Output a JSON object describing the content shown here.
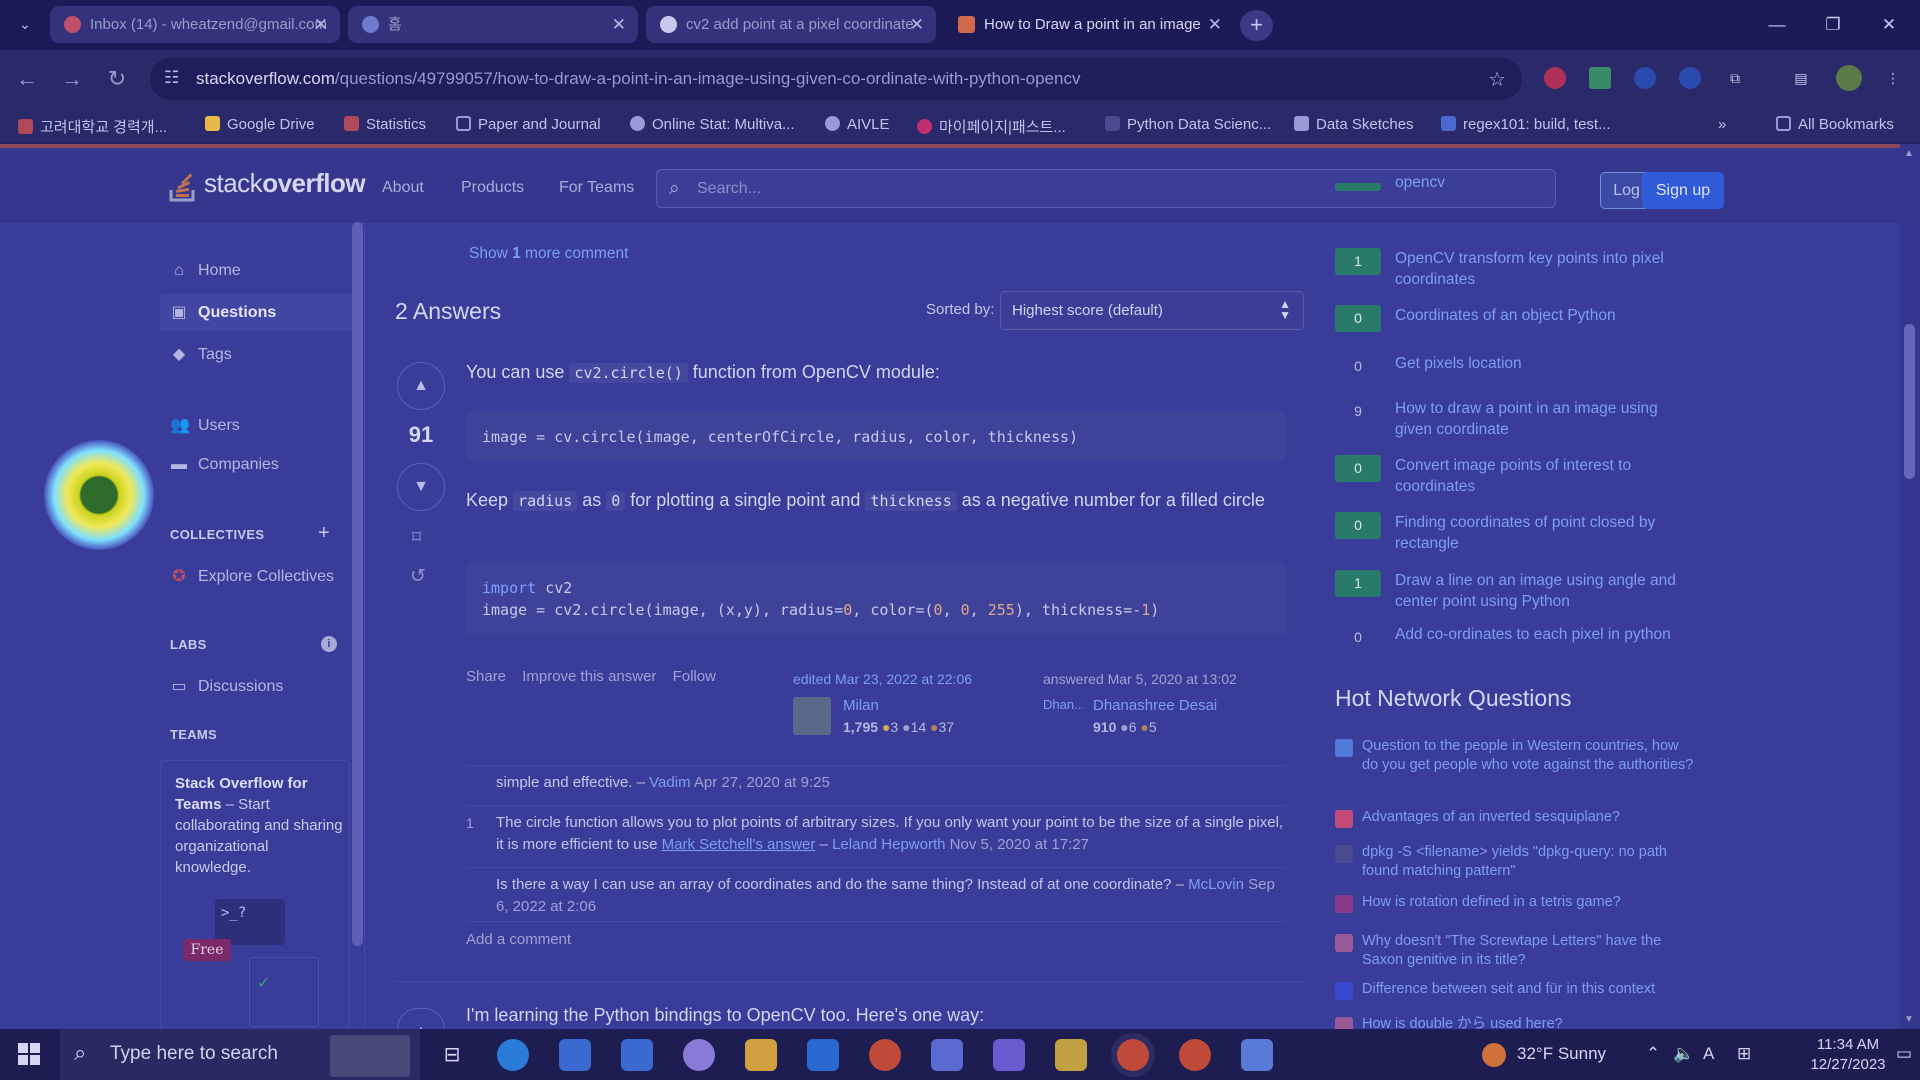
{
  "browser": {
    "tabs": [
      {
        "title": "Inbox (14) - wheatzend@gmail.com",
        "fav_color": "#c0506a"
      },
      {
        "title": "홈",
        "fav_color": "#6c7bd0"
      },
      {
        "title": "cv2 add point at a pixel coordinate",
        "fav_color": "#c9c8ee"
      },
      {
        "title": "How to Draw a point in an image",
        "fav_color": "#d06a4a"
      }
    ],
    "url_host": "stackoverflow.com",
    "url_path": "/questions/49799057/how-to-draw-a-point-in-an-image-using-given-co-ordinate-with-python-opencv",
    "bookmarks": [
      {
        "label": "고려대학교 경력개...",
        "color": "#b04a5a"
      },
      {
        "label": "Google Drive",
        "color": "#e8b84a"
      },
      {
        "label": "Statistics",
        "color": "#b04a5a"
      },
      {
        "label": "Paper and Journal",
        "color": "#9a9ad8"
      },
      {
        "label": "Online Stat: Multiva...",
        "color": "#9a9ad8"
      },
      {
        "label": "AIVLE",
        "color": "#9a9ad8"
      },
      {
        "label": "마이페이지|패스트...",
        "color": "#c03070"
      },
      {
        "label": "Python Data Scienc...",
        "color": "#4a4a90"
      },
      {
        "label": "Data Sketches",
        "color": "#9a9ad8"
      },
      {
        "label": "regex101: build, test...",
        "color": "#4a6ad0"
      }
    ],
    "all_bookmarks": "All Bookmarks",
    "more_bookmarks": "»"
  },
  "header": {
    "logo_prefix": "stack",
    "logo_bold": "overflow",
    "nav": [
      "About",
      "Products",
      "For Teams"
    ],
    "search_placeholder": "Search...",
    "login": "Log in",
    "signup": "Sign up"
  },
  "sidebar": {
    "items": [
      {
        "label": "Home",
        "icon": "home-icon",
        "glyph": "⌂"
      },
      {
        "label": "Questions",
        "icon": "questions-icon",
        "glyph": "▣"
      },
      {
        "label": "Tags",
        "icon": "tag-icon",
        "glyph": "◆"
      },
      {
        "label": "Users",
        "icon": "users-icon",
        "glyph": "👥"
      },
      {
        "label": "Companies",
        "icon": "briefcase-icon",
        "glyph": "▬"
      }
    ],
    "collectives_title": "COLLECTIVES",
    "explore_collectives": "Explore Collectives",
    "labs_title": "LABS",
    "discussions": "Discussions",
    "teams_title": "TEAMS",
    "teams_heading": "Stack Overflow for Teams",
    "teams_text": " – Start collaborating and sharing organizational knowledge.",
    "teams_badge": "Free",
    "teams_prompt": ">_?"
  },
  "main": {
    "show_more_pre": "Show ",
    "show_more_num": "1",
    "show_more_post": " more comment",
    "answers_heading": "2 Answers",
    "sorted_by": "Sorted by:",
    "sort_value": "Highest score (default)",
    "answer1": {
      "score": "91",
      "p1_pre": "You can use ",
      "p1_code": "cv2.circle()",
      "p1_post": " function from OpenCV module:",
      "code1": "image = cv.circle(image, centerOfCircle, radius, color, thickness)",
      "p2_a": "Keep ",
      "p2_code1": "radius",
      "p2_b": " as ",
      "p2_code2": "0",
      "p2_c": " for plotting a single point and ",
      "p2_code3": "thickness",
      "p2_d": " as a negative number for a filled circle",
      "code2_kw": "import",
      "code2_mod": " cv2",
      "code2_line2_pre": "image = cv2.circle(image, (x,y), radius=",
      "code2_r": "0",
      "code2_mid": ", color=(",
      "code2_c1": "0",
      "code2_sep": ", ",
      "code2_c2": "0",
      "code2_c3": "255",
      "code2_mid2": "), thickness=-",
      "code2_t": "1",
      "code2_end": ")",
      "actions": [
        "Share",
        "Improve this answer",
        "Follow"
      ],
      "edited": "edited Mar 23, 2022 at 22:06",
      "editor": "Milan",
      "editor_rep": "1,795",
      "editor_gold": "3",
      "editor_silver": "14",
      "editor_bronze": "37",
      "answered": "answered Mar 5, 2020 at 13:02",
      "author": "Dhanashree Desai",
      "author_img_alt": "Dhan...",
      "author_rep": "910",
      "author_silver": "6",
      "author_bronze": "5"
    },
    "comments": [
      {
        "num": "",
        "text": "simple and effective. – ",
        "user": "Vadim",
        "date": " Apr 27, 2020 at 9:25"
      },
      {
        "num": "1",
        "text": "The circle function allows you to plot points of arbitrary sizes. If you only want your point to be the size of a single pixel, it is more efficient to use ",
        "link": "Mark Setchell's answer",
        "text2": " – ",
        "user": "Leland Hepworth",
        "date": " Nov 5, 2020 at 17:27"
      },
      {
        "num": "",
        "text": "Is there a way I can use an array of coordinates and do the same thing? Instead of at one coordinate? – ",
        "user": "McLovin",
        "date": " Sep 6, 2022 at 2:06"
      }
    ],
    "add_comment": "Add a comment",
    "answer2_intro": "I'm learning the Python bindings to OpenCV too. Here's one way:"
  },
  "related": [
    {
      "score": "",
      "title": "opencv",
      "accepted": true
    },
    {
      "score": "1",
      "title": "OpenCV transform key points into pixel coordinates",
      "accepted": true
    },
    {
      "score": "0",
      "title": "Coordinates of an object Python",
      "accepted": true
    },
    {
      "score": "0",
      "title": "Get pixels location",
      "accepted": false
    },
    {
      "score": "9",
      "title": "How to draw a point in an image using given coordinate",
      "accepted": false
    },
    {
      "score": "0",
      "title": "Convert image points of interest to coordinates",
      "accepted": true
    },
    {
      "score": "0",
      "title": "Finding coordinates of point closed by rectangle",
      "accepted": true
    },
    {
      "score": "1",
      "title": "Draw a line on an image using angle and center point using Python",
      "accepted": true
    },
    {
      "score": "0",
      "title": "Add co-ordinates to each pixel in python",
      "accepted": false
    }
  ],
  "hot_network": {
    "title": "Hot Network Questions",
    "items": [
      {
        "text": "Question to the people in Western countries, how do you get people who vote against the authorities?",
        "site_color": "#4f7ad8"
      },
      {
        "text": "Advantages of an inverted sesquiplane?",
        "site_color": "#c04a78"
      },
      {
        "text": "dpkg -S <filename> yields \"dpkg-query: no path found matching pattern\"",
        "site_color": "#4a4a90"
      },
      {
        "text": "How is rotation defined in a tetris game?",
        "site_color": "#8a3a8a"
      },
      {
        "text": "Why doesn't \"The Screwtape Letters\" have the Saxon genitive in its title?",
        "site_color": "#9a5a9a"
      },
      {
        "text": "Difference between seit and für in this context",
        "site_color": "#3a4ad0"
      },
      {
        "text": "How is double から used here?",
        "site_color": "#9a5a9a"
      }
    ]
  },
  "taskbar": {
    "search_placeholder": "Type here to search",
    "weather": "32°F  Sunny",
    "time": "11:34 AM",
    "date": "12/27/2023"
  }
}
